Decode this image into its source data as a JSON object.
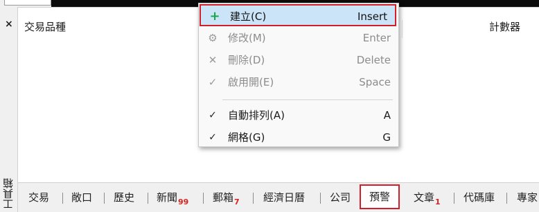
{
  "toolbox": {
    "close_glyph": "×",
    "label": "工具箱"
  },
  "columns": {
    "symbol": "交易品種",
    "counter": "計數器"
  },
  "context_menu": {
    "items": [
      {
        "label": "建立(C)",
        "shortcut": "Insert",
        "icon": "plus-icon",
        "state": "highlighted"
      },
      {
        "label": "修改(M)",
        "shortcut": "Enter",
        "icon": "gear-icon",
        "state": "disabled"
      },
      {
        "label": "刪除(D)",
        "shortcut": "Delete",
        "icon": "close-icon",
        "state": "disabled"
      },
      {
        "label": "啟用開(E)",
        "shortcut": "Space",
        "icon": "check-circle-icon",
        "state": "disabled"
      },
      {
        "label": "自動排列(A)",
        "shortcut": "A",
        "icon": "checkmark-icon",
        "state": "checked"
      },
      {
        "label": "網格(G)",
        "shortcut": "G",
        "icon": "checkmark-icon",
        "state": "checked"
      }
    ]
  },
  "tabs": [
    {
      "label": "交易",
      "badge": ""
    },
    {
      "label": "敞口",
      "badge": ""
    },
    {
      "label": "歷史",
      "badge": ""
    },
    {
      "label": "新聞",
      "badge": "99"
    },
    {
      "label": "郵箱",
      "badge": "7"
    },
    {
      "label": "經濟日曆",
      "badge": ""
    },
    {
      "label": "公司",
      "badge": ""
    },
    {
      "label": "預警",
      "badge": "",
      "active": true
    },
    {
      "label": "文章",
      "badge": "1"
    },
    {
      "label": "代碼庫",
      "badge": ""
    },
    {
      "label": "專家",
      "badge": ""
    }
  ],
  "colors": {
    "highlight_border": "#d01f2a",
    "highlight_bg": "#cce4f7",
    "badge": "#d42323",
    "plus_icon": "#19a64a"
  }
}
